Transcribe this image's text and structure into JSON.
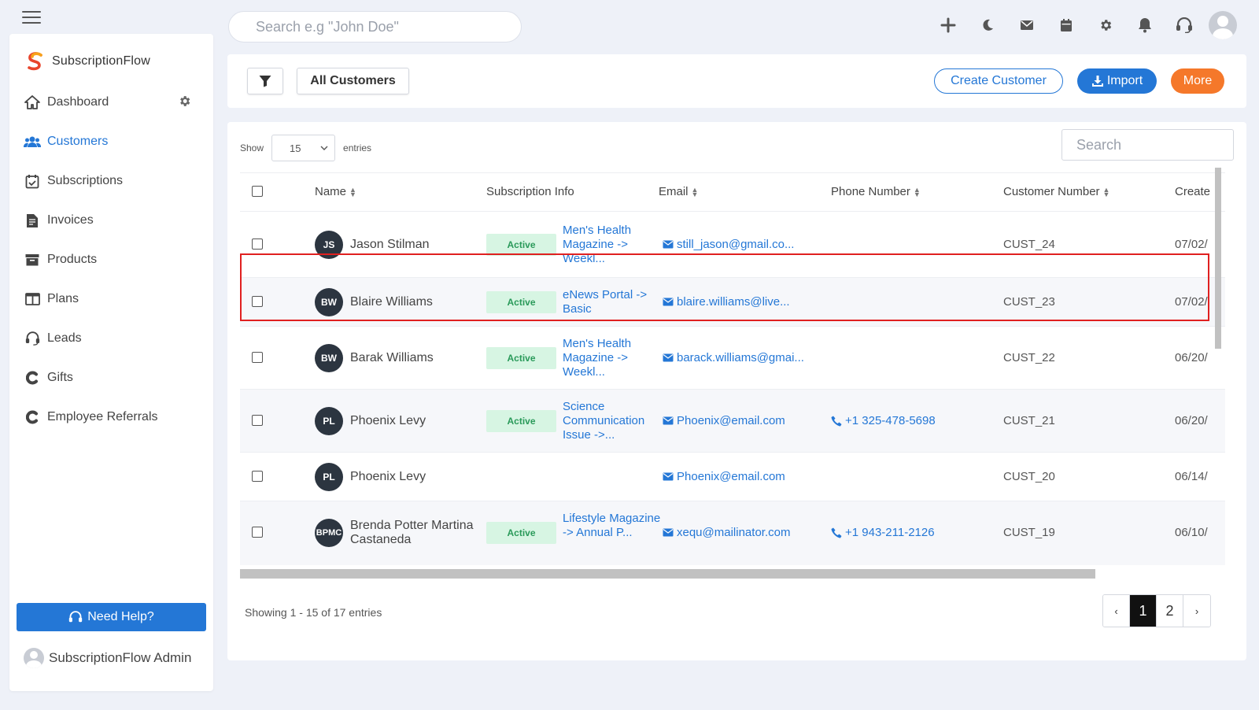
{
  "topbar": {
    "search_placeholder": "Search e.g \"John Doe\"",
    "icons": [
      "plus-icon",
      "moon-icon",
      "mail-icon",
      "calendar-icon",
      "gear-icon",
      "bell-icon",
      "headset-icon",
      "user-avatar"
    ]
  },
  "sidebar": {
    "brand": "SubscriptionFlow",
    "items": [
      {
        "label": "Dashboard",
        "icon": "home-icon"
      },
      {
        "label": "Customers",
        "icon": "users-icon",
        "active": true
      },
      {
        "label": "Subscriptions",
        "icon": "calendar-check-icon"
      },
      {
        "label": "Invoices",
        "icon": "invoice-icon"
      },
      {
        "label": "Products",
        "icon": "archive-icon"
      },
      {
        "label": "Plans",
        "icon": "columns-icon"
      },
      {
        "label": "Leads",
        "icon": "headset-icon"
      },
      {
        "label": "Gifts",
        "icon": "c-icon"
      },
      {
        "label": "Employee Referrals",
        "icon": "c-icon"
      }
    ],
    "help_label": "Need Help?",
    "admin_label": "SubscriptionFlow Admin"
  },
  "toolbar": {
    "view_label": "All Customers",
    "create_label": "Create Customer",
    "import_label": "Import",
    "more_label": "More"
  },
  "table": {
    "show_label": "Show",
    "entries_value": "15",
    "entries_label": "entries",
    "search_placeholder": "Search",
    "columns": {
      "name": "Name",
      "subscription": "Subscription Info",
      "email": "Email",
      "phone": "Phone Number",
      "customer_number": "Customer Number",
      "created": "Create"
    },
    "rows": [
      {
        "initials": "JS",
        "name": "Jason Stilman",
        "status": "Active",
        "subscription": "Men's Health Magazine -> Weekl...",
        "email": "still_jason@gmail.co...",
        "phone": "",
        "customer_number": "CUST_24",
        "created": "07/02/"
      },
      {
        "initials": "BW",
        "name": "Blaire Williams",
        "status": "Active",
        "subscription": "eNews Portal -> Basic",
        "email": "blaire.williams@live...",
        "phone": "",
        "customer_number": "CUST_23",
        "created": "07/02/"
      },
      {
        "initials": "BW",
        "name": "Barak Williams",
        "status": "Active",
        "subscription": "Men's Health Magazine -> Weekl...",
        "email": "barack.williams@gmai...",
        "phone": "",
        "customer_number": "CUST_22",
        "created": "06/20/"
      },
      {
        "initials": "PL",
        "name": "Phoenix Levy",
        "status": "Active",
        "subscription": "Science Communication Issue ->...",
        "email": "Phoenix@email.com",
        "phone": "+1 325-478-5698",
        "customer_number": "CUST_21",
        "created": "06/20/"
      },
      {
        "initials": "PL",
        "name": "Phoenix Levy",
        "status": "",
        "subscription": "",
        "email": "Phoenix@email.com",
        "phone": "",
        "customer_number": "CUST_20",
        "created": "06/14/"
      },
      {
        "initials": "BPMC",
        "name": "Brenda Potter Martina Castaneda",
        "status": "Active",
        "subscription": "Lifestyle Magazine -> Annual P...",
        "email": "xequ@mailinator.com",
        "phone": "+1 943-211-2126",
        "customer_number": "CUST_19",
        "created": "06/10/"
      }
    ],
    "showing_text": "Showing 1 - 15 of 17 entries",
    "pagination": {
      "prev": "‹",
      "pages": [
        "1",
        "2"
      ],
      "next": "›",
      "current": "1"
    }
  }
}
